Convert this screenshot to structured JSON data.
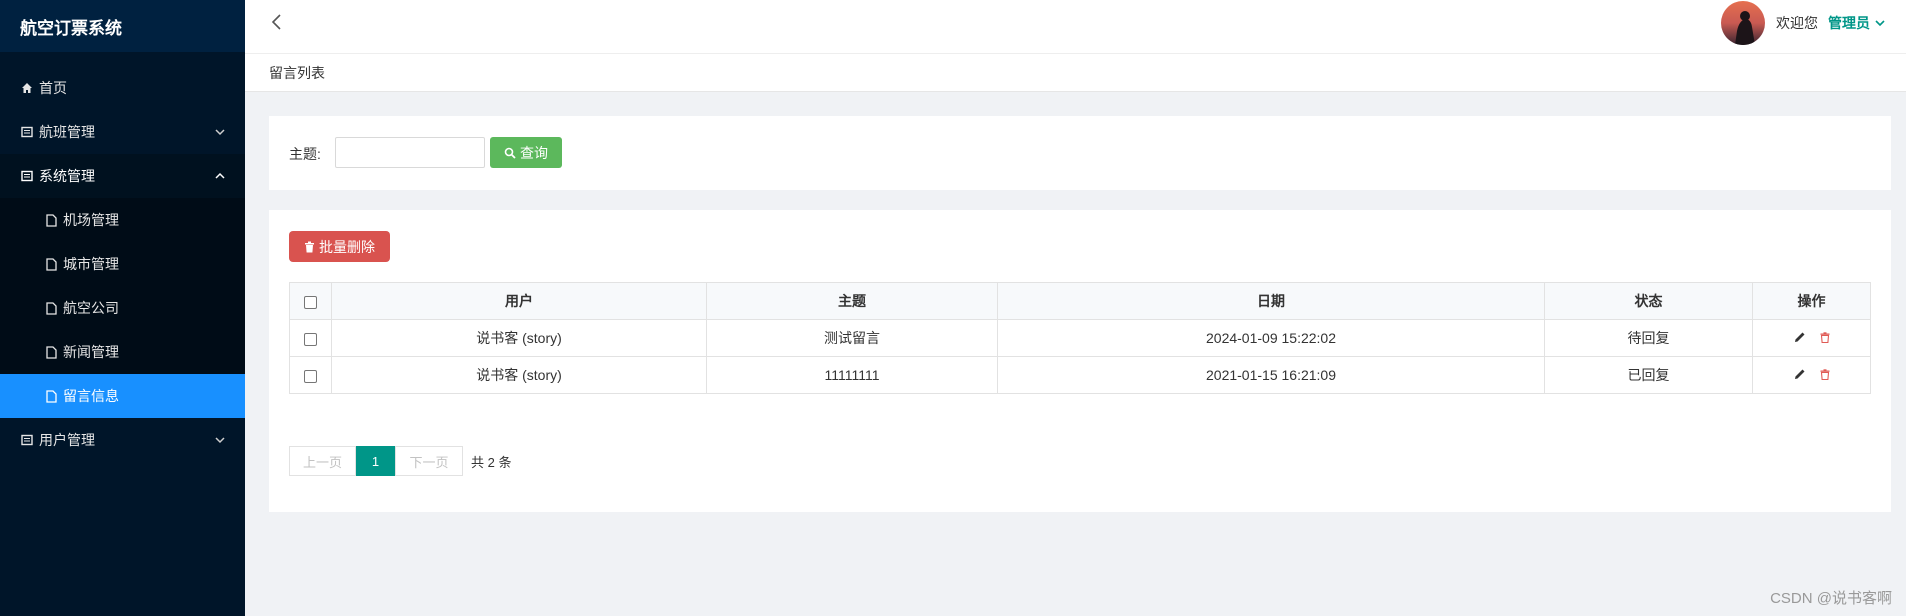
{
  "app": {
    "title": "航空订票系统"
  },
  "sidebar": {
    "items": [
      {
        "label": "首页"
      },
      {
        "label": "航班管理"
      },
      {
        "label": "系统管理"
      },
      {
        "label": "用户管理"
      }
    ],
    "system_children": [
      {
        "label": "机场管理"
      },
      {
        "label": "城市管理"
      },
      {
        "label": "航空公司"
      },
      {
        "label": "新闻管理"
      },
      {
        "label": "留言信息"
      }
    ]
  },
  "header": {
    "welcome": "欢迎您",
    "role": "管理员"
  },
  "breadcrumb": {
    "current": "留言列表"
  },
  "search": {
    "label": "主题:",
    "value": "",
    "placeholder": "",
    "button": "查询"
  },
  "toolbar": {
    "batch_delete": "批量删除"
  },
  "table": {
    "headers": [
      "用户",
      "主题",
      "日期",
      "状态",
      "操作"
    ],
    "rows": [
      {
        "user": "说书客 (story)",
        "subject": "测试留言",
        "date": "2024-01-09 15:22:02",
        "status": "待回复"
      },
      {
        "user": "说书客 (story)",
        "subject": "11111111",
        "date": "2021-01-15 16:21:09",
        "status": "已回复"
      }
    ]
  },
  "pagination": {
    "prev": "上一页",
    "current": "1",
    "next": "下一页",
    "total": "共 2 条"
  },
  "watermark": "CSDN @说书客啊",
  "colors": {
    "sidebar_bg": "#001529",
    "active": "#1890ff",
    "query_btn": "#5cb85c",
    "delete_btn": "#d9534f",
    "pager_active": "#009688"
  }
}
